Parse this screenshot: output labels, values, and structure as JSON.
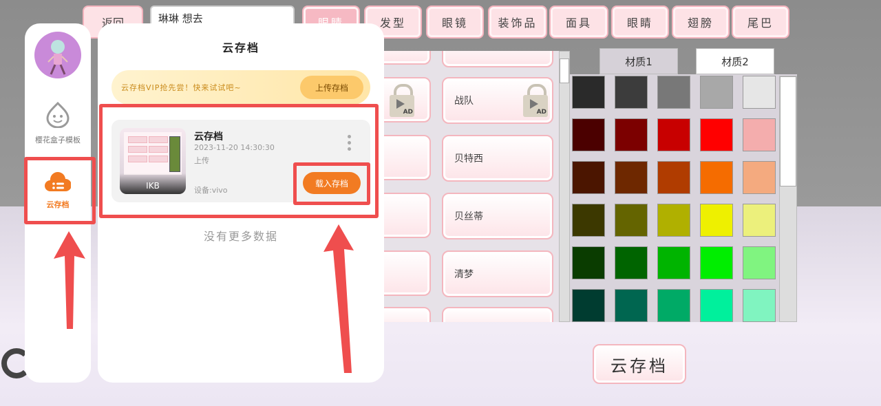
{
  "top_bar": {
    "back_label": "返回",
    "name_input_value": "琳琳 想去",
    "tabs": [
      {
        "label": "眼睛"
      },
      {
        "label": "发型"
      },
      {
        "label": "眼镜"
      },
      {
        "label": "装饰品"
      },
      {
        "label": "面具"
      },
      {
        "label": "眼睛"
      },
      {
        "label": "翅膀"
      },
      {
        "label": "尾巴"
      }
    ]
  },
  "items": {
    "right_column": [
      {
        "label": "战队",
        "locked": true
      },
      {
        "label": "贝特西",
        "locked": false
      },
      {
        "label": "贝丝蒂",
        "locked": false
      },
      {
        "label": "清梦",
        "locked": false
      }
    ],
    "ad_badge": "AD"
  },
  "material_tabs": [
    "材质1",
    "材质2"
  ],
  "colors": {
    "swatches": [
      [
        "#2a2a2a",
        "#3c3c3c",
        "#787878",
        "#a8a8a8",
        "#e6e6e6"
      ],
      [
        "#4b0000",
        "#7c0000",
        "#c80000",
        "#ff0000",
        "#f4adad"
      ],
      [
        "#4b1500",
        "#6e2800",
        "#b03c00",
        "#f56c00",
        "#f4aa7f"
      ],
      [
        "#3c3800",
        "#646400",
        "#b0b000",
        "#eef000",
        "#ecf07c"
      ],
      [
        "#0a3c00",
        "#006400",
        "#00b400",
        "#00ee00",
        "#80f480"
      ],
      [
        "#003c30",
        "#006650",
        "#00aa66",
        "#00f09c",
        "#80f4c0"
      ]
    ]
  },
  "cloud_save_button": "云存档",
  "sidebar": {
    "template_label": "樱花盒子模板",
    "cloud_label": "云存档",
    "accent_color": "#f27b22"
  },
  "panel": {
    "title": "云存档",
    "vip_text": "云存档VIP抢先尝！快来试试吧~",
    "upload_label": "上传存档",
    "save": {
      "name": "云存档",
      "date": "2023-11-20 14:30:30",
      "status": "上传",
      "device": "设备:vivo",
      "thumb_caption": "IKB",
      "load_label": "载入存档"
    },
    "no_more": "没有更多数据"
  },
  "annotation_color": "#ef4e4e"
}
